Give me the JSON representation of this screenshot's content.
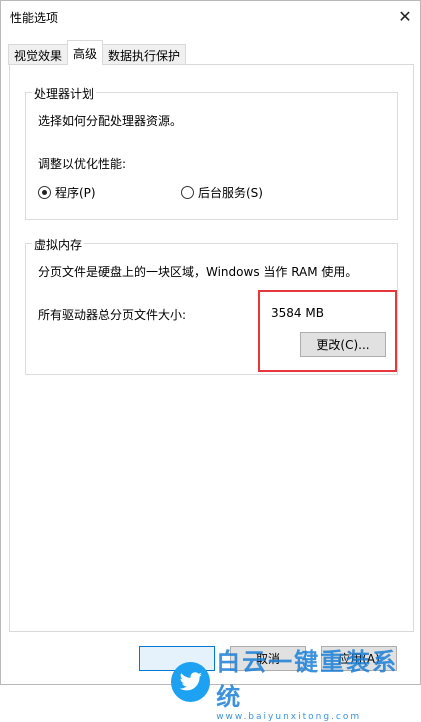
{
  "window": {
    "title": "性能选项",
    "close_glyph": "✕"
  },
  "tabs": [
    {
      "label": "视觉效果"
    },
    {
      "label": "高级",
      "active": true
    },
    {
      "label": "数据执行保护"
    }
  ],
  "processor_group": {
    "title": "处理器计划",
    "description": "选择如何分配处理器资源。",
    "adjust_label": "调整以优化性能:",
    "options": [
      {
        "label": "程序(P)",
        "checked": true
      },
      {
        "label": "后台服务(S)",
        "checked": false
      }
    ]
  },
  "virtual_memory_group": {
    "title": "虚拟内存",
    "description": "分页文件是硬盘上的一块区域，Windows 当作 RAM 使用。",
    "total_label": "所有驱动器总分页文件大小:",
    "total_value": "3584 MB",
    "change_button": "更改(C)..."
  },
  "footer": {
    "cancel_button": "取消",
    "apply_button": "应用(A)"
  },
  "watermark": {
    "main": "白云一键重装系统",
    "url": "www.baiyunxitong.com"
  },
  "colors": {
    "highlight": "#e8373b",
    "watermark": "#1b7fd8",
    "bird": "#1da1f2"
  }
}
